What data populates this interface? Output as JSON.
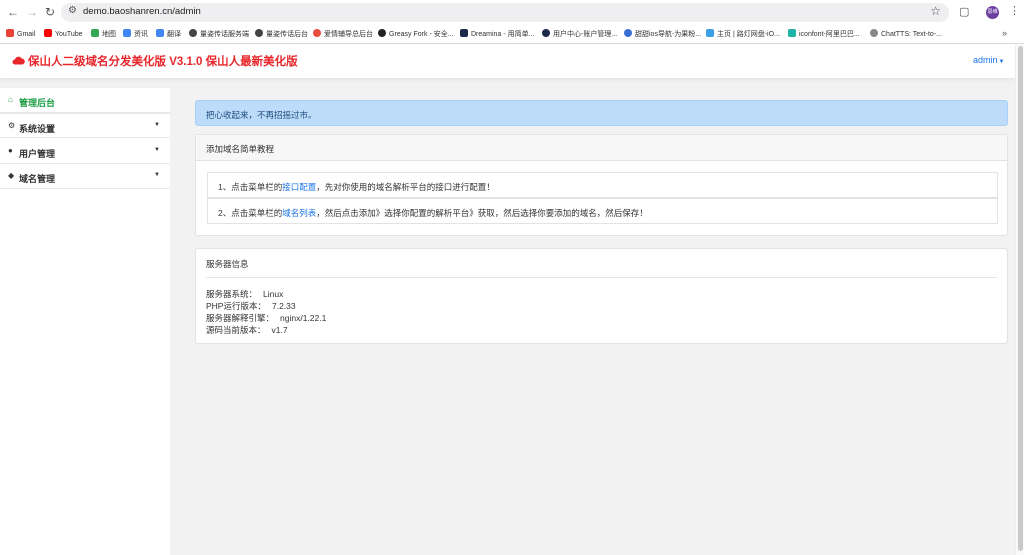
{
  "browser": {
    "url": "demo.baoshanren.cn/admin",
    "profile_label": "思维",
    "bookmarks": [
      {
        "label": "Gmail",
        "color": "#ea4335"
      },
      {
        "label": "YouTube",
        "color": "#ff0000"
      },
      {
        "label": "地图",
        "color": "#34a853"
      },
      {
        "label": "资讯",
        "color": "#4285f4"
      },
      {
        "label": "翻译",
        "color": "#4285f4"
      },
      {
        "label": "量姿传话服务端",
        "color": "#444444"
      },
      {
        "label": "量姿传话后台",
        "color": "#444444"
      },
      {
        "label": "爱情辅导总后台",
        "color": "#e74c3c"
      },
      {
        "label": "Greasy Fork - 安全...",
        "color": "#222222"
      },
      {
        "label": "Dreamina - 用简单...",
        "color": "#1b2a4a"
      },
      {
        "label": "用户中心-账户管理...",
        "color": "#1b2a4a"
      },
      {
        "label": "甜甜ios导航-为果粉...",
        "color": "#3b6fd8"
      },
      {
        "label": "主页 | 路灯网盘-iO...",
        "color": "#3ba0e6"
      },
      {
        "label": "iconfont-阿里巴巴...",
        "color": "#1fb5a5"
      },
      {
        "label": "ChatTTS: Text-to-...",
        "color": "#888888"
      }
    ]
  },
  "header": {
    "brand": "保山人二级域名分发美化版 V3.1.0 保山人最新美化版",
    "user": "admin",
    "brand_color": "#e8262b"
  },
  "sidebar": {
    "items": [
      {
        "label": "管理后台"
      },
      {
        "label": "系统设置"
      },
      {
        "label": "用户管理"
      },
      {
        "label": "域名管理"
      }
    ]
  },
  "alert": {
    "text": "把心收起来，不再招摇过市。"
  },
  "tutorial": {
    "title": "添加域名简单教程",
    "step1": {
      "prefix": "1、点击菜单栏的",
      "link": "接口配置",
      "suffix": "，先对你使用的域名解析平台的接口进行配置！"
    },
    "step2": {
      "prefix": "2、点击菜单栏的",
      "link": "域名列表",
      "suffix": "，然后点击添加》选择你配置的解析平台》获取，然后选择你要添加的域名，然后保存！"
    }
  },
  "server": {
    "title": "服务器信息",
    "rows": [
      {
        "label": "服务器系统：",
        "value": "Linux"
      },
      {
        "label": "PHP运行版本：",
        "value": "7.2.33"
      },
      {
        "label": "服务器解释引擎：",
        "value": "nginx/1.22.1"
      },
      {
        "label": "源码当前版本：",
        "value": "v1.7"
      }
    ]
  },
  "icons": {
    "brand": "cloud-icon",
    "dashboard": "home-icon",
    "settings": "gear-icon",
    "users": "user-icon",
    "domains": "cube-icon"
  }
}
